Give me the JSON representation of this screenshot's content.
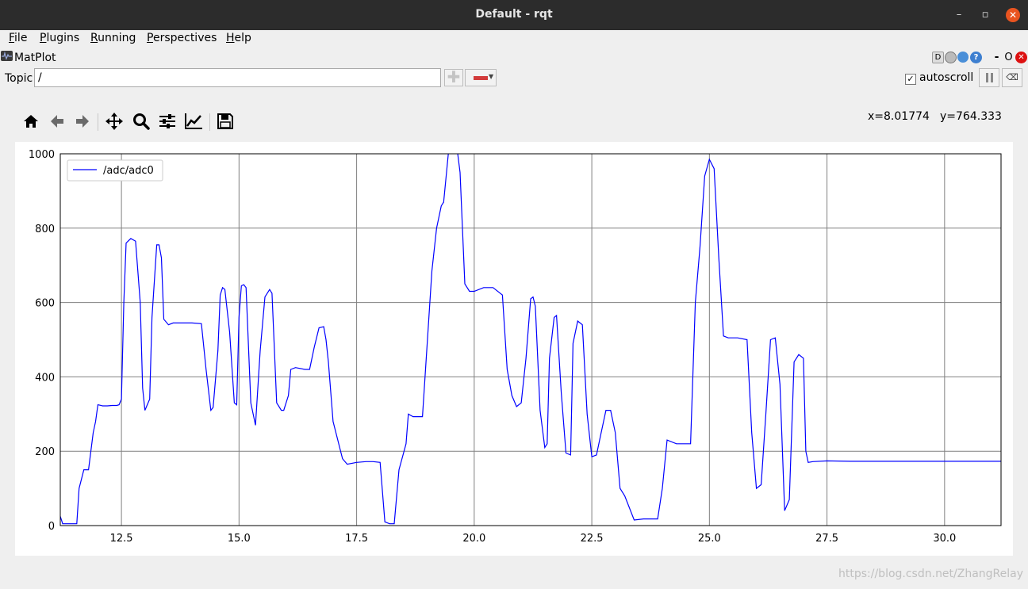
{
  "window": {
    "title": "Default - rqt",
    "minimize_glyph": "–",
    "maximize_glyph": "▫",
    "close_glyph": "✕"
  },
  "menubar": [
    {
      "key": "F",
      "rest": "ile"
    },
    {
      "key": "P",
      "rest": "lugins"
    },
    {
      "key": "R",
      "rest": "unning"
    },
    {
      "key": "P",
      "rest": "erspectives"
    },
    {
      "key": "H",
      "rest": "elp"
    }
  ],
  "plugin": {
    "title": "MatPlot",
    "icon": "waveform-icon",
    "header_buttons": {
      "d_label": "D",
      "help_label": "?",
      "minimize_label": "-",
      "float_label": "O"
    }
  },
  "topic": {
    "label": "Topic",
    "value": "/",
    "add_icon": "plus-icon",
    "remove_icon": "minus-icon"
  },
  "autoscroll": {
    "label": "autoscroll",
    "checked": true,
    "check_glyph": "✓"
  },
  "toolbar_icons": [
    "home-icon",
    "back-icon",
    "forward-icon",
    "pan-icon",
    "zoom-icon",
    "configure-subplots-icon",
    "edit-axes-icon",
    "save-icon"
  ],
  "cursor": {
    "x_text": "x=8.01774",
    "y_text": "y=764.333"
  },
  "colors": {
    "line": "#0000ff",
    "grid": "#808080",
    "titlebar": "#2c2c2c",
    "close": "#e95420"
  },
  "chart_data": {
    "type": "line",
    "series": [
      {
        "name": "/adc/adc0"
      }
    ],
    "xlim": [
      11.2,
      31.2
    ],
    "ylim": [
      0,
      1000
    ],
    "xticks": [
      "12.5",
      "15.0",
      "17.5",
      "20.0",
      "22.5",
      "25.0",
      "27.5",
      "30.0"
    ],
    "yticks": [
      "0",
      "200",
      "400",
      "600",
      "800",
      "1000"
    ],
    "grid": true,
    "legend_position": "upper-left",
    "x": [
      11.2,
      11.25,
      11.35,
      11.55,
      11.6,
      11.7,
      11.8,
      11.9,
      11.95,
      12.0,
      12.1,
      12.2,
      12.3,
      12.4,
      12.45,
      12.5,
      12.55,
      12.6,
      12.7,
      12.8,
      12.9,
      12.95,
      13.0,
      13.1,
      13.15,
      13.25,
      13.3,
      13.35,
      13.4,
      13.5,
      13.6,
      14.0,
      14.2,
      14.3,
      14.4,
      14.45,
      14.55,
      14.6,
      14.65,
      14.7,
      14.8,
      14.9,
      14.95,
      15.0,
      15.05,
      15.1,
      15.15,
      15.25,
      15.35,
      15.45,
      15.55,
      15.65,
      15.7,
      15.8,
      15.9,
      15.95,
      16.05,
      16.1,
      16.2,
      16.4,
      16.5,
      16.6,
      16.7,
      16.8,
      16.85,
      16.9,
      17.0,
      17.2,
      17.3,
      17.5,
      17.7,
      17.85,
      18.0,
      18.1,
      18.2,
      18.3,
      18.4,
      18.55,
      18.6,
      18.7,
      18.8,
      18.9,
      19.1,
      19.2,
      19.3,
      19.35,
      19.45,
      19.5,
      19.6,
      19.7,
      19.75,
      19.8,
      19.9,
      20.0,
      20.2,
      20.4,
      20.6,
      20.7,
      20.8,
      20.9,
      21.0,
      21.1,
      21.2,
      21.25,
      21.3,
      21.4,
      21.5,
      21.55,
      21.6,
      21.7,
      21.75,
      21.85,
      21.95,
      22.05,
      22.1,
      22.2,
      22.3,
      22.4,
      22.5,
      22.6,
      22.7,
      22.8,
      22.9,
      23.0,
      23.1,
      23.2,
      23.4,
      23.6,
      23.8,
      23.9,
      24.0,
      24.1,
      24.3,
      24.5,
      24.6,
      24.7,
      24.8,
      24.9,
      25.0,
      25.1,
      25.2,
      25.3,
      25.4,
      25.6,
      25.8,
      25.9,
      26.0,
      26.1,
      26.2,
      26.3,
      26.4,
      26.5,
      26.6,
      26.7,
      26.8,
      26.9,
      27.0,
      27.05,
      27.1,
      27.2,
      27.5,
      28.0,
      29.0,
      30.0,
      31.2
    ],
    "y": [
      25,
      5,
      5,
      5,
      100,
      150,
      150,
      250,
      280,
      325,
      322,
      322,
      323,
      323,
      325,
      340,
      600,
      760,
      772,
      765,
      600,
      370,
      310,
      340,
      560,
      755,
      755,
      720,
      555,
      540,
      545,
      545,
      543,
      420,
      310,
      318,
      470,
      620,
      640,
      635,
      520,
      330,
      325,
      560,
      645,
      648,
      640,
      330,
      270,
      470,
      615,
      635,
      625,
      330,
      310,
      310,
      350,
      420,
      425,
      420,
      420,
      480,
      532,
      535,
      500,
      440,
      280,
      180,
      165,
      170,
      172,
      172,
      170,
      10,
      5,
      5,
      150,
      220,
      300,
      293,
      293,
      293,
      685,
      800,
      860,
      870,
      1000,
      1050,
      1050,
      950,
      800,
      650,
      630,
      630,
      640,
      640,
      620,
      420,
      350,
      320,
      330,
      450,
      610,
      615,
      590,
      310,
      210,
      220,
      450,
      560,
      565,
      360,
      195,
      190,
      490,
      550,
      540,
      300,
      185,
      190,
      250,
      310,
      310,
      250,
      100,
      80,
      15,
      18,
      18,
      18,
      100,
      230,
      220,
      220,
      220,
      600,
      750,
      940,
      985,
      960,
      720,
      510,
      505,
      505,
      500,
      250,
      100,
      110,
      300,
      500,
      505,
      380,
      40,
      70,
      440,
      460,
      450,
      200,
      170,
      172,
      174,
      173,
      173,
      173,
      173,
      173
    ]
  },
  "watermark": "https://blog.csdn.net/ZhangRelay"
}
